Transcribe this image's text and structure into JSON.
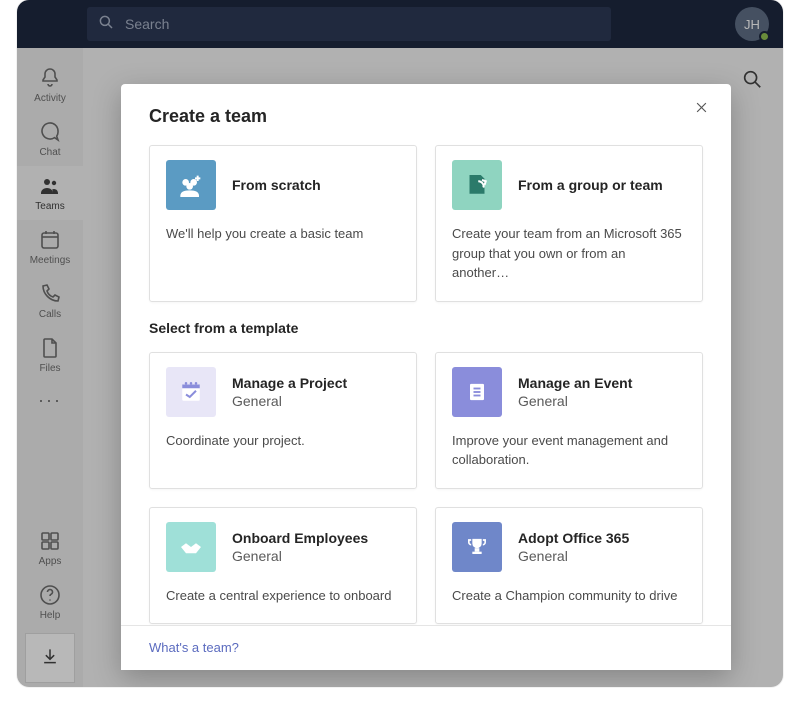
{
  "header": {
    "search_placeholder": "Search",
    "avatar_initials": "JH"
  },
  "sidebar": {
    "items": [
      {
        "label": "Activity"
      },
      {
        "label": "Chat"
      },
      {
        "label": "Teams"
      },
      {
        "label": "Meetings"
      },
      {
        "label": "Calls"
      },
      {
        "label": "Files"
      }
    ],
    "apps_label": "Apps",
    "help_label": "Help"
  },
  "modal": {
    "title": "Create a team",
    "section_title": "Select from a template",
    "footer_link": "What's a team?",
    "top_cards": [
      {
        "title": "From scratch",
        "desc": "We'll help you create a basic team"
      },
      {
        "title": "From a group or team",
        "desc": "Create your team from an Microsoft 365 group that you own or from an another…"
      }
    ],
    "template_cards": [
      {
        "title": "Manage a Project",
        "sub": "General",
        "desc": "Coordinate your project."
      },
      {
        "title": "Manage an Event",
        "sub": "General",
        "desc": "Improve your event management and collaboration."
      },
      {
        "title": "Onboard Employees",
        "sub": "General",
        "desc": "Create a central experience to onboard"
      },
      {
        "title": "Adopt Office 365",
        "sub": "General",
        "desc": "Create a Champion community to drive"
      }
    ]
  },
  "colors": {
    "scratch_icon_bg": "#5b9bc3",
    "group_icon_bg": "#8fd4c0",
    "project_icon_bg": "#e8e6f7",
    "event_icon_bg": "#8a8ddb",
    "onboard_icon_bg": "#9fe0d8",
    "adopt_icon_bg": "#6f87c9"
  }
}
